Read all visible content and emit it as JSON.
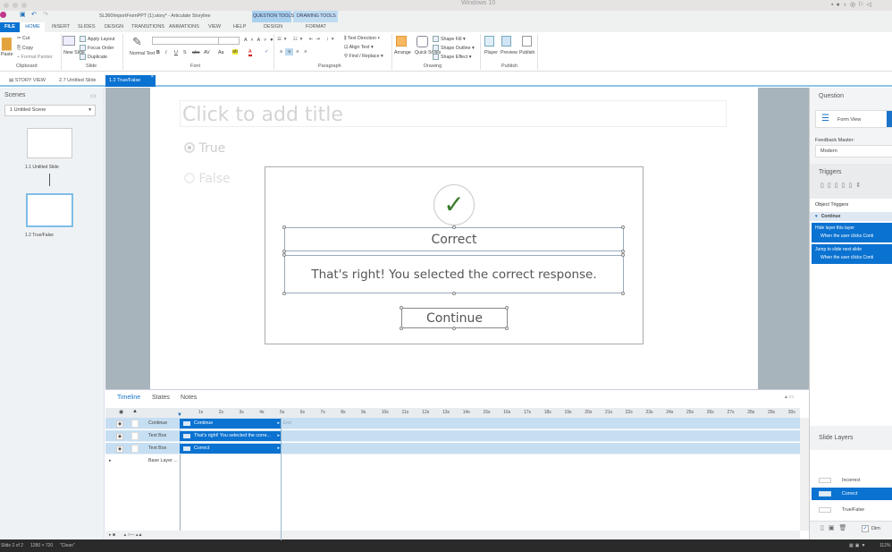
{
  "os": {
    "window_label": "Windows 10"
  },
  "app": {
    "title": "SL360ImportFromPPT (1).story* - Articulate Storyline"
  },
  "ribbon_tabs": [
    "FILE",
    "HOME",
    "INSERT",
    "SLIDES",
    "DESIGN",
    "TRANSITIONS",
    "ANIMATIONS",
    "VIEW",
    "HELP"
  ],
  "context_tabs": {
    "question_tools": "QUESTION TOOLS",
    "question_design": "DESIGN",
    "drawing_tools": "DRAWING TOOLS",
    "drawing_format": "FORMAT"
  },
  "clipboard": {
    "paste": "Paste",
    "cut": "Cut",
    "copy": "Copy",
    "format_painter": "Format Painter",
    "group": "Clipboard"
  },
  "slide_group": {
    "new_slide": "New Slide",
    "apply_layout": "Apply Layout",
    "focus_order": "Focus Order",
    "duplicate": "Duplicate",
    "group": "Slide"
  },
  "font_group": {
    "normal_text": "Normal Text",
    "font_value": "",
    "size_value": "",
    "group": "Font",
    "buttons": [
      "B",
      "I",
      "U",
      "S",
      "abc",
      "AV",
      "Aa"
    ]
  },
  "paragraph": {
    "text_direction": "Text Direction",
    "align_text": "Align Text",
    "find_replace": "Find / Replace",
    "group": "Paragraph"
  },
  "drawing": {
    "arrange": "Arrange",
    "quick_styles": "Quick Styles",
    "shape_fill": "Shape Fill",
    "shape_outline": "Shape Outline",
    "shape_effect": "Shape Effect",
    "group": "Drawing"
  },
  "publish": {
    "player": "Player",
    "preview": "Preview",
    "publish": "Publish",
    "group": "Publish"
  },
  "doc_tabs": [
    "STORY VIEW",
    "2.7 Untitled Slide",
    "1.2 True/False"
  ],
  "scenes": {
    "header": "Scenes",
    "selected": "1 Untitled Scene",
    "slides": [
      "1.1 Untitled Slide",
      "1.2 True/False"
    ]
  },
  "slide": {
    "title_placeholder": "Click to add title",
    "options": [
      "True",
      "False"
    ],
    "feedback_title": "Correct",
    "feedback_text": "That's right!  You selected the correct response.",
    "continue_button": "Continue"
  },
  "timeline": {
    "tabs": [
      "Timeline",
      "States",
      "Notes"
    ],
    "ticks": [
      "1s",
      "2s",
      "3s",
      "4s",
      "5s",
      "6s",
      "7s",
      "8s",
      "9s",
      "10s",
      "11s",
      "12s",
      "13s",
      "14s",
      "15s",
      "16s",
      "17s",
      "18s",
      "19s",
      "20s",
      "21s",
      "22s",
      "23s",
      "24s",
      "25s",
      "26s",
      "27s",
      "28s",
      "29s",
      "30s"
    ],
    "rows": [
      {
        "name": "Continue",
        "bar": "Continue"
      },
      {
        "name": "Text Box",
        "bar": "That's right! You selected the corre..."
      },
      {
        "name": "Text Box",
        "bar": "Correct"
      }
    ],
    "end_label": "End",
    "base_layer": "Base Layer ..."
  },
  "question": {
    "header": "Question",
    "form_view": "Form View",
    "feedback_master_label": "Feedback Master:",
    "feedback_master": "Modern"
  },
  "triggers": {
    "header": "Triggers",
    "object_triggers": "Object Triggers",
    "object": "Continue",
    "items": [
      {
        "action": "Hide layer this layer",
        "condition": "When the user clicks Conti"
      },
      {
        "action": "Jump to slide next slide",
        "condition": "When the user clicks Conti"
      }
    ]
  },
  "layers": {
    "header": "Slide Layers",
    "items": [
      "Incorrect",
      "Correct",
      "True/False"
    ],
    "selected": "Correct",
    "dim": "Dim",
    "dim_checked": true
  },
  "status": {
    "slide": "Slide 2 of 2",
    "size": "1280 × 720",
    "theme": "\"Clean\"",
    "zoom": "112%"
  },
  "colors": {
    "accent": "#0a72d1",
    "context_tab": "#a9d1ee",
    "check": "#3a7a2a"
  }
}
